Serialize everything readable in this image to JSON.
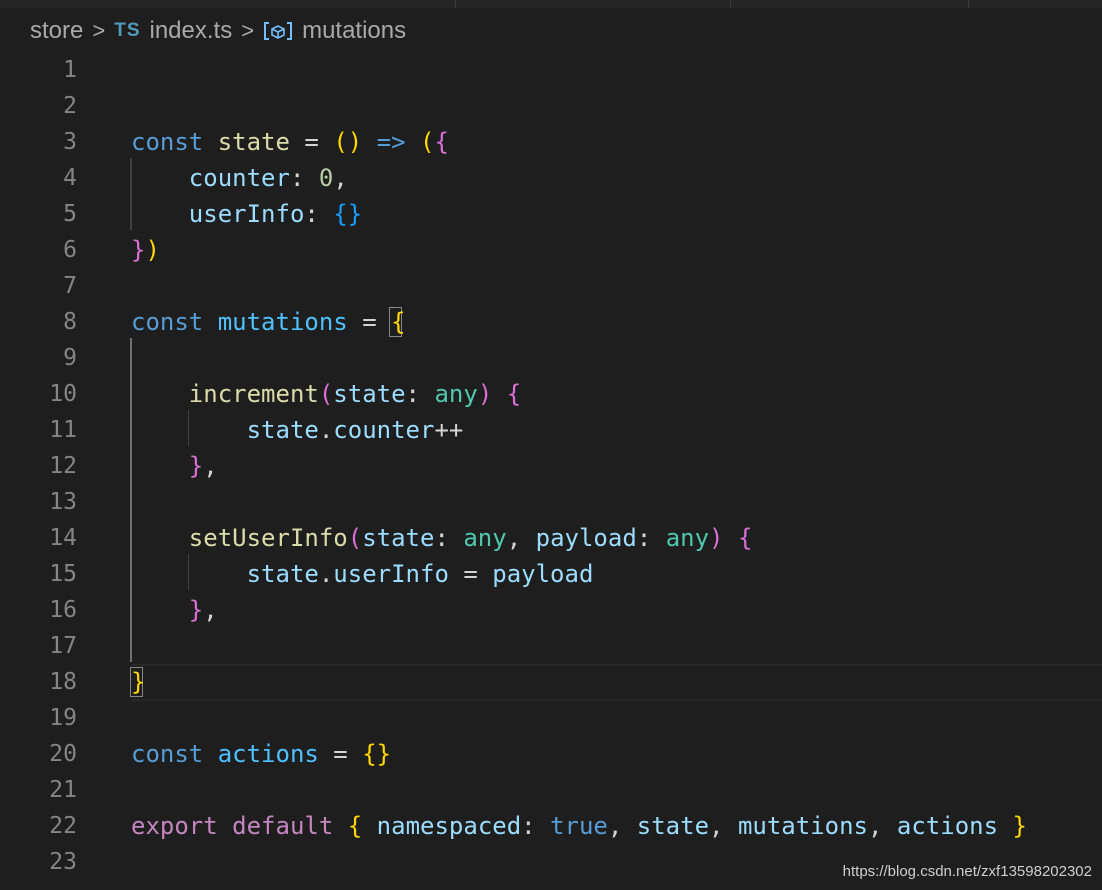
{
  "breadcrumb": {
    "folder": "store",
    "file_badge": "TS",
    "file": "index.ts",
    "symbol": "mutations",
    "separator": ">"
  },
  "editor": {
    "lines": [
      {
        "num": "1"
      },
      {
        "num": "2"
      },
      {
        "num": "3",
        "tokens": [
          {
            "t": "const",
            "c": "kw"
          },
          {
            "t": " "
          },
          {
            "t": "state",
            "c": "fn"
          },
          {
            "t": " = "
          },
          {
            "t": "()",
            "c": "br1"
          },
          {
            "t": " "
          },
          {
            "t": "=>",
            "c": "kw"
          },
          {
            "t": " "
          },
          {
            "t": "(",
            "c": "br1"
          },
          {
            "t": "{",
            "c": "br2"
          }
        ]
      },
      {
        "num": "4",
        "tokens": [
          {
            "t": "    "
          },
          {
            "t": "counter",
            "c": "var"
          },
          {
            "t": ": "
          },
          {
            "t": "0",
            "c": "num"
          },
          {
            "t": ","
          }
        ]
      },
      {
        "num": "5",
        "tokens": [
          {
            "t": "    "
          },
          {
            "t": "userInfo",
            "c": "var"
          },
          {
            "t": ": "
          },
          {
            "t": "{}",
            "c": "br3"
          }
        ]
      },
      {
        "num": "6",
        "tokens": [
          {
            "t": "}",
            "c": "br2"
          },
          {
            "t": ")",
            "c": "br1"
          }
        ]
      },
      {
        "num": "7"
      },
      {
        "num": "8",
        "tokens": [
          {
            "t": "const",
            "c": "kw"
          },
          {
            "t": " "
          },
          {
            "t": "mutations",
            "c": "const-name"
          },
          {
            "t": " = "
          },
          {
            "t": "{",
            "c": "br1"
          }
        ]
      },
      {
        "num": "9"
      },
      {
        "num": "10",
        "tokens": [
          {
            "t": "    "
          },
          {
            "t": "increment",
            "c": "fn"
          },
          {
            "t": "(",
            "c": "br2"
          },
          {
            "t": "state",
            "c": "var"
          },
          {
            "t": ": "
          },
          {
            "t": "any",
            "c": "typ"
          },
          {
            "t": ")",
            "c": "br2"
          },
          {
            "t": " "
          },
          {
            "t": "{",
            "c": "br2"
          }
        ]
      },
      {
        "num": "11",
        "tokens": [
          {
            "t": "        "
          },
          {
            "t": "state",
            "c": "var"
          },
          {
            "t": "."
          },
          {
            "t": "counter",
            "c": "var"
          },
          {
            "t": "++"
          }
        ]
      },
      {
        "num": "12",
        "tokens": [
          {
            "t": "    "
          },
          {
            "t": "}",
            "c": "br2"
          },
          {
            "t": ","
          }
        ]
      },
      {
        "num": "13"
      },
      {
        "num": "14",
        "tokens": [
          {
            "t": "    "
          },
          {
            "t": "setUserInfo",
            "c": "fn"
          },
          {
            "t": "(",
            "c": "br2"
          },
          {
            "t": "state",
            "c": "var"
          },
          {
            "t": ": "
          },
          {
            "t": "any",
            "c": "typ"
          },
          {
            "t": ", "
          },
          {
            "t": "payload",
            "c": "var"
          },
          {
            "t": ": "
          },
          {
            "t": "any",
            "c": "typ"
          },
          {
            "t": ")",
            "c": "br2"
          },
          {
            "t": " "
          },
          {
            "t": "{",
            "c": "br2"
          }
        ]
      },
      {
        "num": "15",
        "tokens": [
          {
            "t": "        "
          },
          {
            "t": "state",
            "c": "var"
          },
          {
            "t": "."
          },
          {
            "t": "userInfo",
            "c": "var"
          },
          {
            "t": " = "
          },
          {
            "t": "payload",
            "c": "var"
          }
        ]
      },
      {
        "num": "16",
        "tokens": [
          {
            "t": "    "
          },
          {
            "t": "}",
            "c": "br2"
          },
          {
            "t": ","
          }
        ]
      },
      {
        "num": "17"
      },
      {
        "num": "18",
        "tokens": [
          {
            "t": "}",
            "c": "br1"
          }
        ]
      },
      {
        "num": "19"
      },
      {
        "num": "20",
        "tokens": [
          {
            "t": "const",
            "c": "kw"
          },
          {
            "t": " "
          },
          {
            "t": "actions",
            "c": "const-name"
          },
          {
            "t": " = "
          },
          {
            "t": "{}",
            "c": "br1"
          }
        ]
      },
      {
        "num": "21"
      },
      {
        "num": "22",
        "tokens": [
          {
            "t": "export",
            "c": "kw2"
          },
          {
            "t": " "
          },
          {
            "t": "default",
            "c": "kw2"
          },
          {
            "t": " "
          },
          {
            "t": "{",
            "c": "br1"
          },
          {
            "t": " "
          },
          {
            "t": "namespaced",
            "c": "var"
          },
          {
            "t": ": "
          },
          {
            "t": "true",
            "c": "kw"
          },
          {
            "t": ", "
          },
          {
            "t": "state",
            "c": "var"
          },
          {
            "t": ", "
          },
          {
            "t": "mutations",
            "c": "var"
          },
          {
            "t": ", "
          },
          {
            "t": "actions",
            "c": "var"
          },
          {
            "t": " "
          },
          {
            "t": "}",
            "c": "br1"
          }
        ]
      },
      {
        "num": "23"
      }
    ]
  },
  "watermark": "https://blog.csdn.net/zxf13598202302",
  "colors": {
    "background": "#1e1e1e",
    "keyword": "#569cd6",
    "function": "#dcdcaa",
    "variable": "#9cdcfe",
    "type": "#4ec9b0",
    "bracket_gold": "#ffd700",
    "bracket_orchid": "#da70d6",
    "bracket_blue": "#179fff"
  }
}
